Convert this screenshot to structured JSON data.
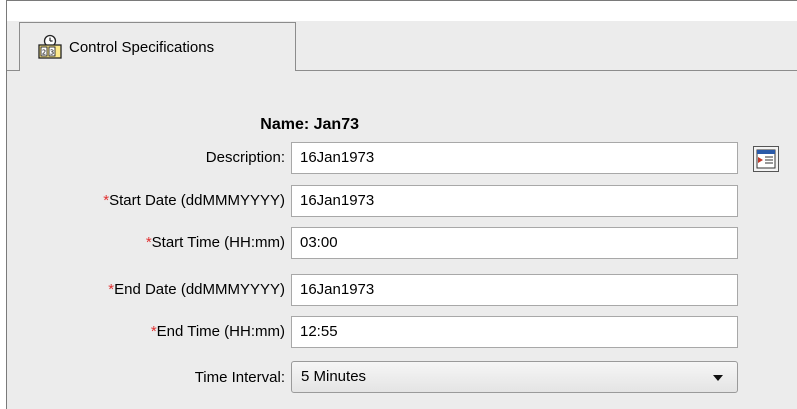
{
  "tab": {
    "label": "Control Specifications",
    "icon": "control-spec-icon"
  },
  "name": {
    "text": "Name: Jan73"
  },
  "fields": {
    "description": {
      "label": "Description:",
      "value": "16Jan1973",
      "required": false
    },
    "start_date": {
      "label": "Start Date (ddMMMYYYY)",
      "value": "16Jan1973",
      "required": true,
      "marker": "*"
    },
    "start_time": {
      "label": "Start Time (HH:mm)",
      "value": "03:00",
      "required": true,
      "marker": "*"
    },
    "end_date": {
      "label": "End Date (ddMMMYYYY)",
      "value": "16Jan1973",
      "required": true,
      "marker": "*"
    },
    "end_time": {
      "label": "End Time (HH:mm)",
      "value": "12:55",
      "required": true,
      "marker": "*"
    },
    "time_interval": {
      "label": "Time Interval:",
      "value": "5 Minutes",
      "required": false
    }
  },
  "colors": {
    "required_marker": "#e03030",
    "panel_bg": "#ececec"
  }
}
